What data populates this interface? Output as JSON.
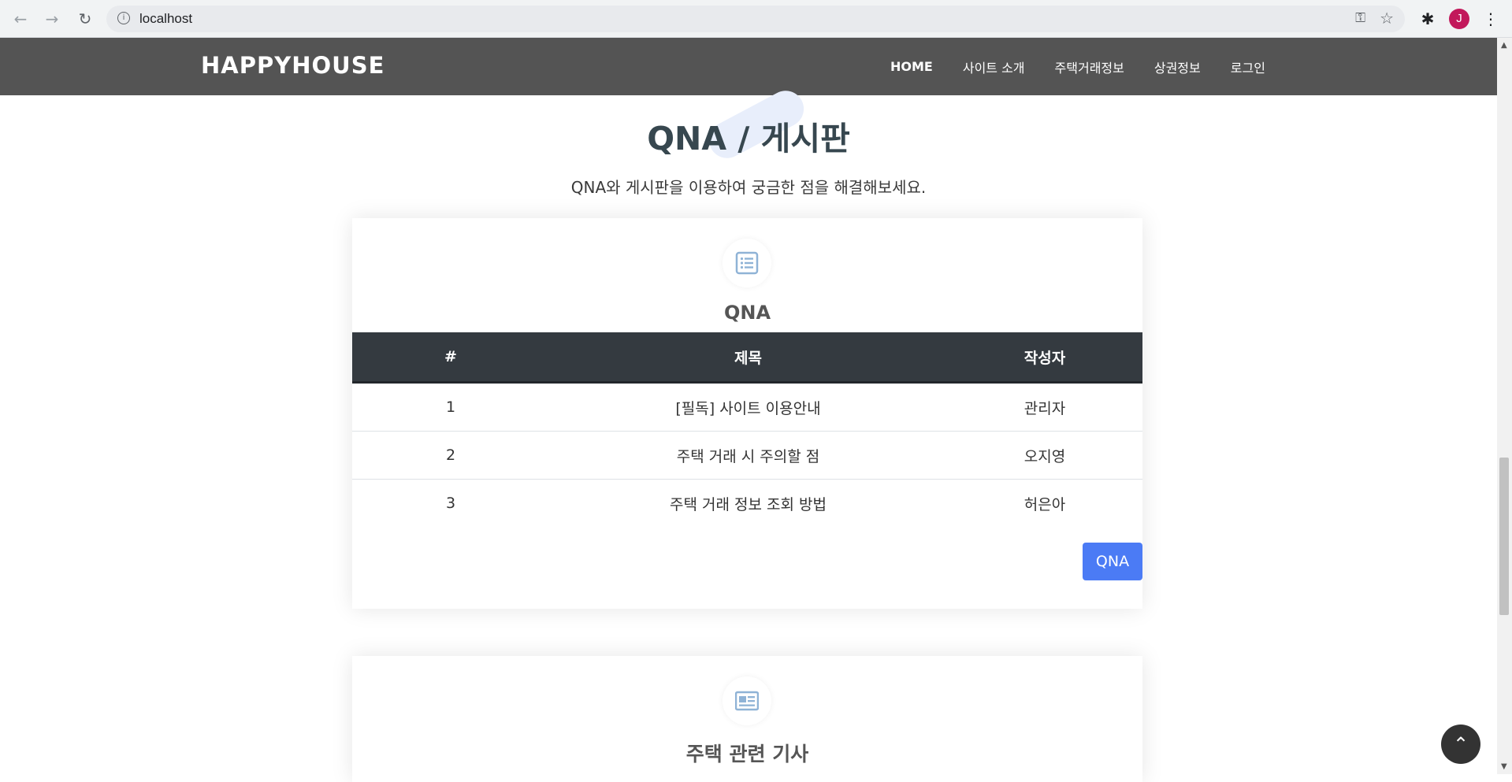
{
  "browser": {
    "url": "localhost",
    "avatar_letter": "J",
    "icons": {
      "back": "arrow-left-icon",
      "forward": "arrow-right-icon",
      "reload": "reload-icon",
      "info": "info-icon",
      "key": "key-icon",
      "bookmark": "star-icon",
      "extensions": "puzzle-icon",
      "menu": "kebab-menu-icon"
    }
  },
  "header": {
    "logo": "HAPPYHOUSE",
    "nav": [
      {
        "label": "HOME",
        "active": true
      },
      {
        "label": "사이트 소개"
      },
      {
        "label": "주택거래정보"
      },
      {
        "label": "상권정보"
      },
      {
        "label": "로그인"
      }
    ]
  },
  "section": {
    "title": "QNA / 게시판",
    "subtitle": "QNA와 게시판을 이용하여 궁금한 점을 해결해보세요."
  },
  "qna_card": {
    "icon": "list-icon",
    "title": "QNA",
    "columns": [
      "#",
      "제목",
      "작성자"
    ],
    "rows": [
      {
        "num": "1",
        "title": "[필독] 사이트 이용안내",
        "writer": "관리자"
      },
      {
        "num": "2",
        "title": "주택 거래 시 주의할 점",
        "writer": "오지영"
      },
      {
        "num": "3",
        "title": "주택 거래 정보 조회 방법",
        "writer": "허은아"
      }
    ],
    "button_label": "QNA"
  },
  "news_card": {
    "icon": "newspaper-icon",
    "title": "주택 관련 기사"
  },
  "colors": {
    "header_bg": "#545454",
    "table_header_bg": "#343a40",
    "accent": "#4b7bf5",
    "icon_color": "#8fb3d6"
  }
}
